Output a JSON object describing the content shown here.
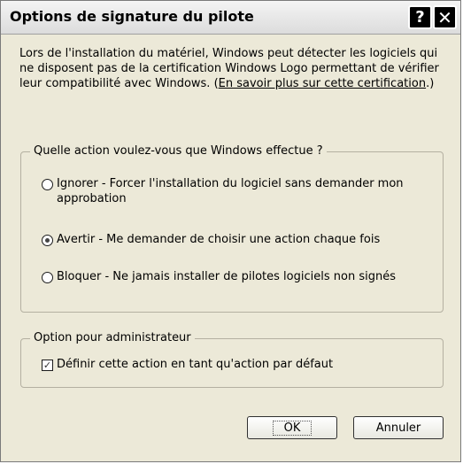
{
  "window": {
    "title": "Options de signature du pilote",
    "help_glyph": "?",
    "close_glyph": "✕"
  },
  "description": {
    "text": "Lors de l'installation du matériel, Windows peut détecter les logiciels qui ne disposent pas de la certification Windows Logo permettant de vérifier leur compatibilité avec Windows. (",
    "link": "En savoir plus sur cette certification",
    "suffix": ".)"
  },
  "action_group": {
    "label": "Quelle action voulez-vous que Windows effectue ?",
    "options": [
      {
        "label": "Ignorer - Forcer l'installation du logiciel sans demander mon approbation",
        "checked": false
      },
      {
        "label": "Avertir - Me demander de choisir une action chaque fois",
        "checked": true
      },
      {
        "label": "Bloquer - Ne jamais installer de pilotes logiciels non signés",
        "checked": false
      }
    ]
  },
  "admin_group": {
    "label": "Option pour administrateur",
    "checkbox_label": "Définir cette action en tant qu'action par défaut",
    "checkbox_checked": true,
    "check_glyph": "✓"
  },
  "buttons": {
    "ok": "OK",
    "cancel": "Annuler"
  }
}
